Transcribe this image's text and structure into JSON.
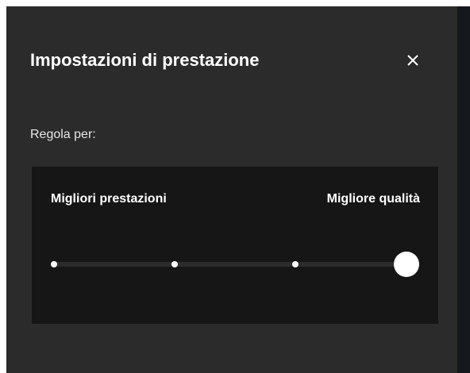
{
  "dialog": {
    "title": "Impostazioni di prestazione",
    "close_icon": "close-icon"
  },
  "adjust": {
    "label": "Regola per:"
  },
  "slider": {
    "min_label": "Migliori prestazioni",
    "max_label": "Migliore qualità",
    "steps": 4,
    "selected_step": 4,
    "level_fraction": 1.0
  },
  "colors": {
    "panel_bg": "#2b2b2b",
    "slider_box_bg": "#161616",
    "text": "#ffffff",
    "thumb": "#ffffff"
  }
}
